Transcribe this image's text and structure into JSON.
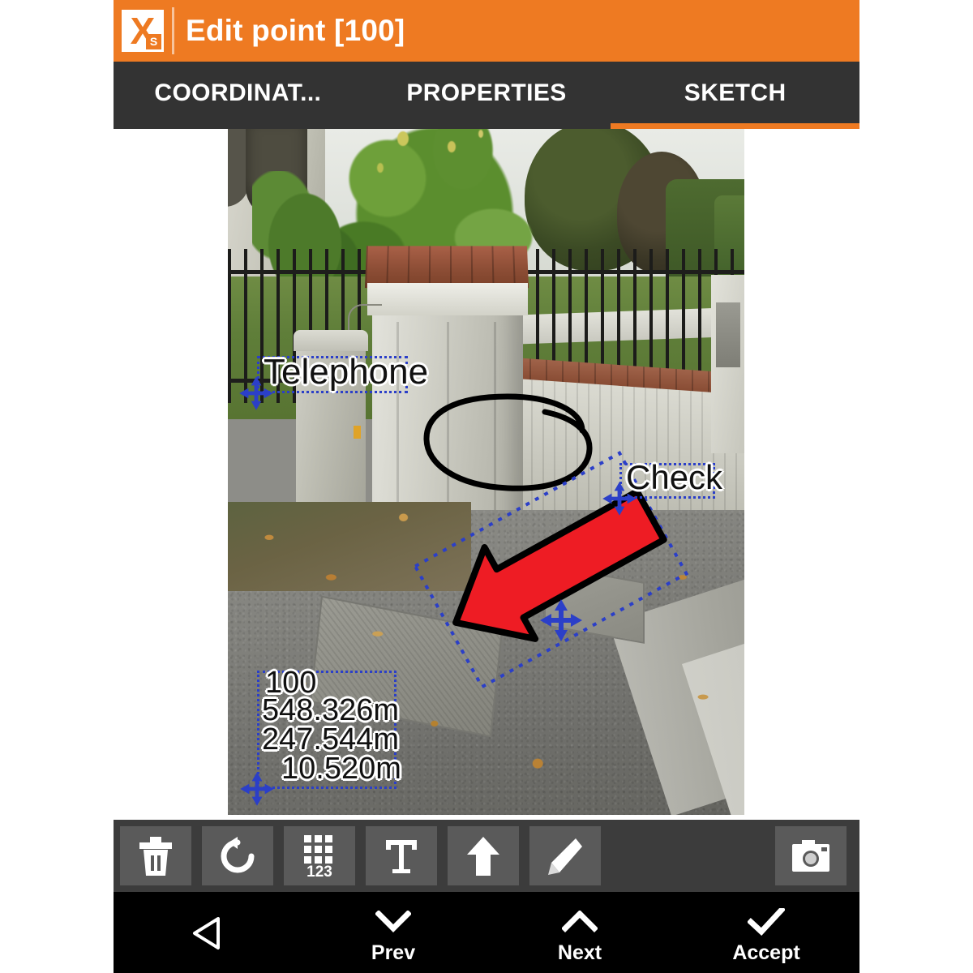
{
  "app": {
    "icon_name": "xpad-survey-app-icon",
    "icon_letter": "X",
    "icon_badge": "S",
    "title": "Edit point [100]",
    "accent_color": "#ee7a22",
    "tabbar_color": "#333333",
    "toolbar_color": "#3c3c3c",
    "toolbutton_color": "#5a5a5a",
    "navbar_color": "#000000"
  },
  "tabs": [
    {
      "label": "COORDINAT...",
      "name": "tab-coordinates",
      "active": false
    },
    {
      "label": "PROPERTIES",
      "name": "tab-properties",
      "active": false
    },
    {
      "label": "SKETCH",
      "name": "tab-sketch",
      "active": true
    }
  ],
  "sketch": {
    "annotation_color": "#2b3fc8",
    "arrow_fill": "#ee1c24",
    "arrow_stroke": "#000000",
    "freehand_color": "#000000",
    "labels": [
      {
        "name": "annotation-label-telephone",
        "text": "Telephone"
      },
      {
        "name": "annotation-label-check",
        "text": "Check"
      }
    ],
    "point_info": {
      "name": "annotation-point-info",
      "point_id": "100",
      "north": "548.326m",
      "east": "247.544m",
      "elevation": "10.520m"
    },
    "shapes": [
      {
        "name": "annotation-red-arrow",
        "type": "arrow"
      },
      {
        "name": "annotation-freehand-circle",
        "type": "freehand-ellipse"
      }
    ]
  },
  "toolbar": {
    "buttons": [
      {
        "name": "delete-button",
        "icon": "trash-icon",
        "label": "Delete"
      },
      {
        "name": "undo-button",
        "icon": "undo-icon",
        "label": "Undo"
      },
      {
        "name": "numeric-button",
        "icon": "keypad-123-icon",
        "label": "123"
      },
      {
        "name": "text-button",
        "icon": "text-t-icon",
        "label": "Text"
      },
      {
        "name": "arrow-button",
        "icon": "arrow-up-icon",
        "label": "Arrow"
      },
      {
        "name": "pencil-button",
        "icon": "pencil-icon",
        "label": "Draw"
      },
      {
        "name": "camera-button",
        "icon": "camera-icon",
        "label": "Camera"
      }
    ]
  },
  "navbar": {
    "items": [
      {
        "name": "nav-back",
        "icon": "back-triangle-icon",
        "label": ""
      },
      {
        "name": "nav-prev",
        "icon": "chevron-down-icon",
        "label": "Prev"
      },
      {
        "name": "nav-next",
        "icon": "chevron-up-icon",
        "label": "Next"
      },
      {
        "name": "nav-accept",
        "icon": "checkmark-icon",
        "label": "Accept"
      }
    ]
  }
}
